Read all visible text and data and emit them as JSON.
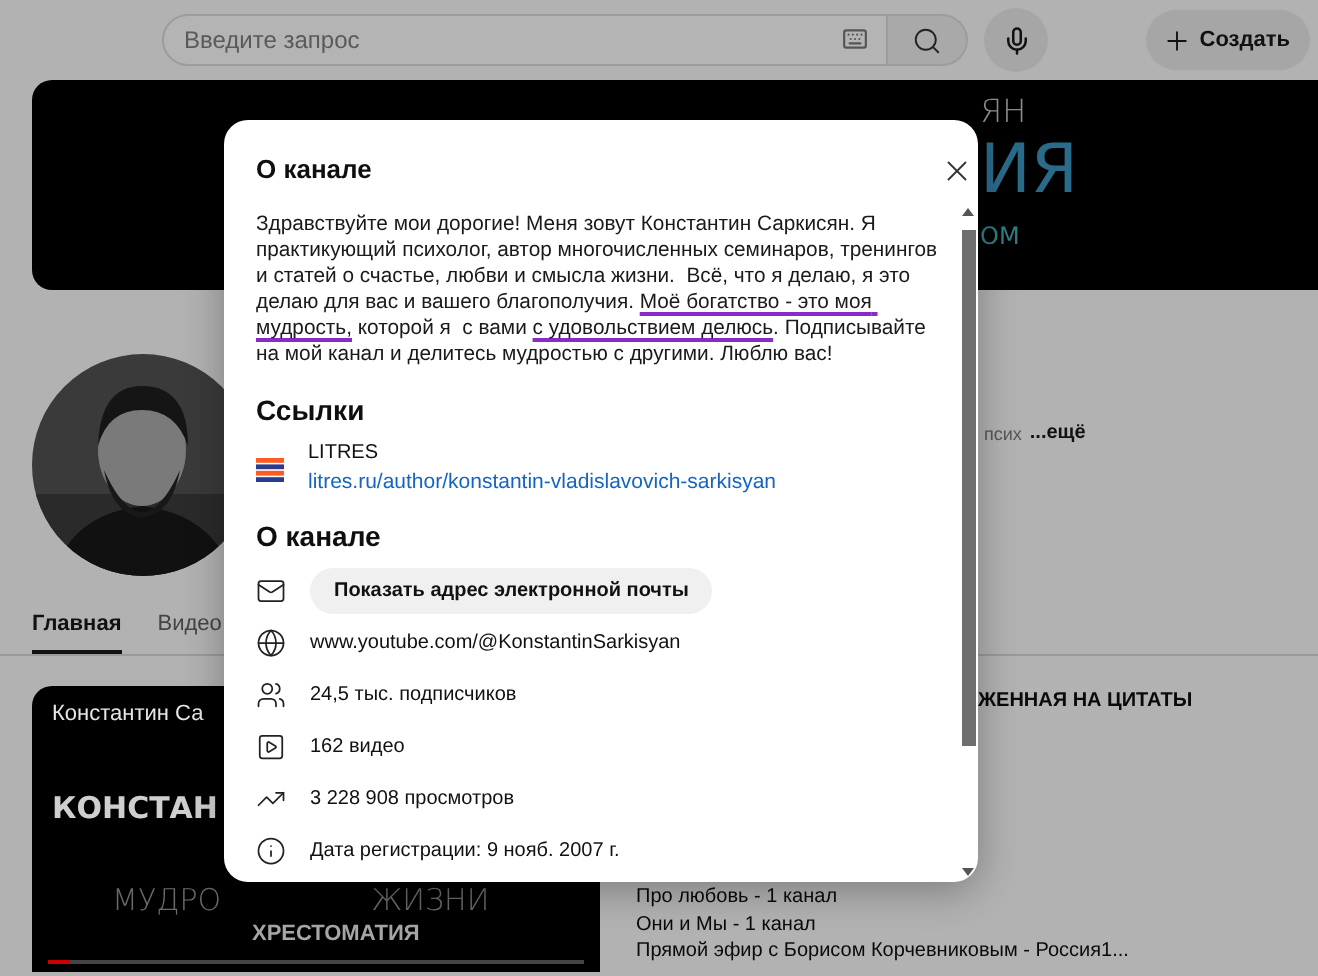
{
  "topbar": {
    "search": {
      "placeholder": "Введите запрос"
    },
    "create_button": "Создать"
  },
  "banner": {
    "lines": [
      {
        "text": "ЯН",
        "kind": "small"
      },
      {
        "text": "ИЯ",
        "kind": "large"
      },
      {
        "text": "ОМ",
        "kind": "accent"
      }
    ]
  },
  "channel": {
    "description_tail": "псих",
    "more_link": "...ещё"
  },
  "tabs": [
    {
      "label": "Главная",
      "selected": true
    },
    {
      "label": "Видео",
      "selected": false
    }
  ],
  "featured_video": {
    "channel_title": "Константин Са",
    "progress": {
      "level": 0.04
    },
    "cover_lines": [
      {
        "text": "КОНСТАН",
        "kind": "bold"
      },
      {
        "text": "МУДРО",
        "kind": "thin"
      },
      {
        "text": "ЖИЗНИ",
        "kind": "thin_right"
      },
      {
        "text": "ХРЕСТОМАТИЯ",
        "kind": "caption"
      }
    ]
  },
  "playlist": {
    "title": "ЖЕННАЯ НА ЦИТАТЫ",
    "items": [
      "Про любовь - 1 канал",
      "Они и Мы - 1 канал",
      "Прямой эфир с Борисом Корчевниковым - Россия1..."
    ]
  },
  "dialog": {
    "title": "О канале",
    "description": [
      {
        "text": "Здравствуйте мои дорогие! Меня зовут Константин Саркисян. Я практикующий психолог, автор многочисленных семинаров, тренингов и статей о счастье, любви и смысла жизни.  Всё, что я делаю, я это делаю для вас и вашего благополучия. ",
        "underlined": false
      },
      {
        "text": "Моё богатство - это моя мудрость,",
        "underlined": true
      },
      {
        "text": " которой я  с вами ",
        "underlined": false
      },
      {
        "text": "с удовольствием делюсь",
        "underlined": true
      },
      {
        "text": ". Подписывайте на мой канал и делитесь мудростью с другими. Люблю вас!",
        "underlined": false
      }
    ],
    "links_heading": "Ссылки",
    "links": [
      {
        "title": "LITRES",
        "url": "litres.ru/author/konstantin-vladislavovich-sarkisyan"
      }
    ],
    "details_heading": "О канале",
    "details": [
      {
        "kind": "email",
        "button": "Показать адрес электронной почты"
      },
      {
        "kind": "site",
        "text": "www.youtube.com/@KonstantinSarkisyan"
      },
      {
        "kind": "subscribers",
        "text": "24,5 тыс. подписчиков"
      },
      {
        "kind": "videos",
        "text": "162 видео"
      },
      {
        "kind": "views",
        "text": "3 228 908 просмотров"
      },
      {
        "kind": "joined",
        "text": "Дата регистрации: 9 нояб. 2007 г."
      }
    ]
  }
}
